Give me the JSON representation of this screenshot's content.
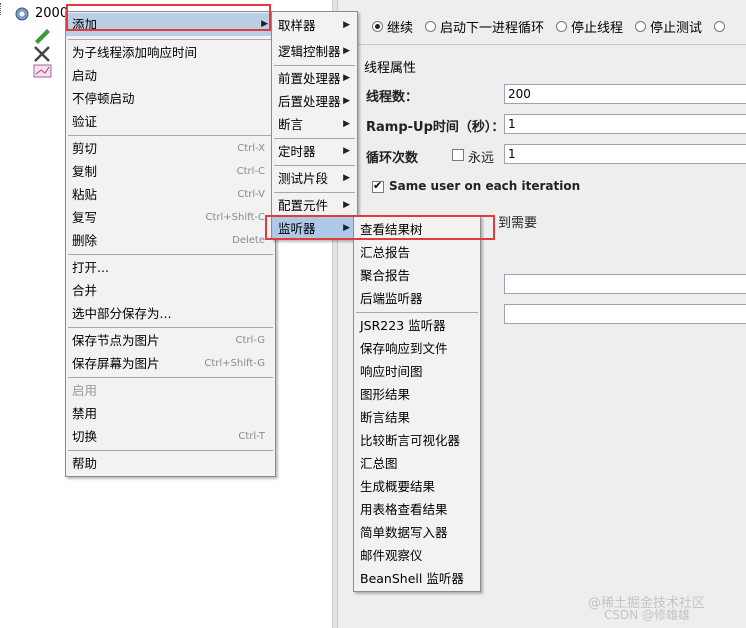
{
  "tree": {
    "node_label": "2000"
  },
  "threads_panel": {
    "radio_options": [
      {
        "label": "继续",
        "selected": true
      },
      {
        "label": "启动下一进程循环",
        "selected": false
      },
      {
        "label": "停止线程",
        "selected": false
      },
      {
        "label": "停止测试",
        "selected": false
      }
    ],
    "group_title": "线程属性",
    "thread_count_label": "线程数：",
    "thread_count_value": "200",
    "rampup_label": "Ramp-Up时间（秒）：",
    "rampup_value": "1",
    "loop_label": "循环次数",
    "forever_label": "永远",
    "loop_value": "1",
    "same_user_label": "Same user on each iteration",
    "partial_text": "到需要"
  },
  "context_menu": {
    "items": [
      {
        "label": "添加",
        "submenu": true
      },
      {
        "label": "为子线程添加响应时间"
      },
      {
        "label": "启动"
      },
      {
        "label": "不停顿启动"
      },
      {
        "label": "验证"
      },
      {
        "label": "剪切",
        "shortcut": "Ctrl-X"
      },
      {
        "label": "复制",
        "shortcut": "Ctrl-C"
      },
      {
        "label": "粘贴",
        "shortcut": "Ctrl-V"
      },
      {
        "label": "复写",
        "shortcut": "Ctrl+Shift-C"
      },
      {
        "label": "删除",
        "shortcut": "Delete"
      },
      {
        "label": "打开..."
      },
      {
        "label": "合并"
      },
      {
        "label": "选中部分保存为..."
      },
      {
        "label": "保存节点为图片",
        "shortcut": "Ctrl-G"
      },
      {
        "label": "保存屏幕为图片",
        "shortcut": "Ctrl+Shift-G"
      },
      {
        "label": "启用",
        "disabled": true
      },
      {
        "label": "禁用"
      },
      {
        "label": "切换",
        "shortcut": "Ctrl-T"
      },
      {
        "label": "帮助"
      }
    ]
  },
  "add_submenu": {
    "items": [
      {
        "label": "取样器"
      },
      {
        "label": "逻辑控制器"
      },
      {
        "label": "前置处理器"
      },
      {
        "label": "后置处理器"
      },
      {
        "label": "断言"
      },
      {
        "label": "定时器"
      },
      {
        "label": "测试片段"
      },
      {
        "label": "配置元件"
      },
      {
        "label": "监听器"
      }
    ]
  },
  "listener_submenu": {
    "items": [
      {
        "label": "查看结果树"
      },
      {
        "label": "汇总报告"
      },
      {
        "label": "聚合报告"
      },
      {
        "label": "后端监听器"
      },
      {
        "label": "JSR223 监听器"
      },
      {
        "label": "保存响应到文件"
      },
      {
        "label": "响应时间图"
      },
      {
        "label": "图形结果"
      },
      {
        "label": "断言结果"
      },
      {
        "label": "比较断言可视化器"
      },
      {
        "label": "汇总图"
      },
      {
        "label": "生成概要结果"
      },
      {
        "label": "用表格查看结果"
      },
      {
        "label": "简单数据写入器"
      },
      {
        "label": "邮件观察仪"
      },
      {
        "label": "BeanShell 监听器"
      }
    ]
  },
  "watermark": {
    "line1": "@稀土掘金技术社区",
    "line2": "CSDN @修雄雄"
  },
  "colors": {
    "highlight_box": "#e23b3b",
    "selection": "#b8cfe5"
  }
}
